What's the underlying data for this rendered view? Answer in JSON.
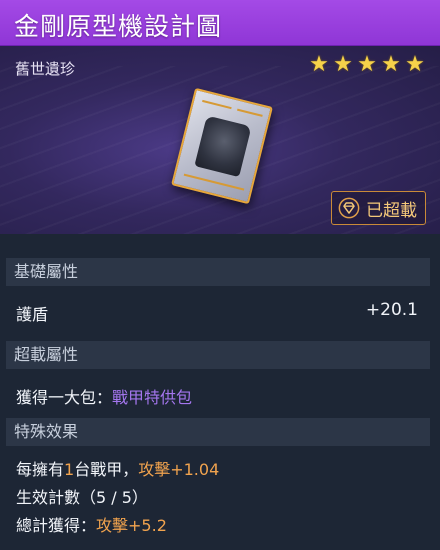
{
  "item": {
    "name": "金剛原型機設計圖",
    "rarity": "舊世遺珍",
    "stars": 5,
    "status": "已超載"
  },
  "sections": {
    "base": {
      "title": "基礎屬性",
      "stat_label": "護盾",
      "stat_value": "+20.1"
    },
    "overload": {
      "title": "超載屬性",
      "line_prefix": "獲得一大包：",
      "line_highlight": "戰甲特供包"
    },
    "special": {
      "title": "特殊效果",
      "line1_a": "每擁有",
      "line1_b": "1",
      "line1_c": "台戰甲，",
      "line1_d": "攻擊+1.04",
      "line2": "生效計數（5 / 5）",
      "line3_a": "總計獲得：",
      "line3_b": "攻擊+5.2"
    }
  },
  "colors": {
    "title_bar": "#9b42e0",
    "star": "#f6d24a",
    "highlight_purple": "#a476ee",
    "highlight_orange": "#f1a34e",
    "equipped_border": "#c98a38"
  },
  "icons": {
    "star": "star-icon",
    "equipped": "overload-gem-icon"
  }
}
